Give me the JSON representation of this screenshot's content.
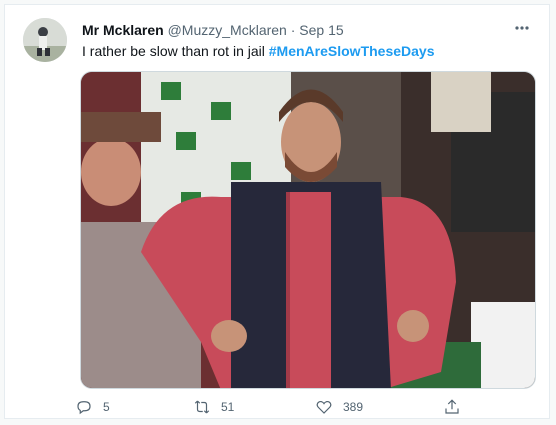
{
  "tweet": {
    "author": {
      "display_name": "Mr Mcklaren",
      "handle": "@Muzzy_Mcklaren",
      "separator": "·",
      "date": "Sep 15"
    },
    "text": "I rather be slow than rot in jail",
    "hashtag": "#MenAreSlowTheseDays",
    "media_alt": "Man in checked shirt and navy vest standing with hands on hips in a stadium crowd",
    "actions": {
      "reply_count": "5",
      "retweet_count": "51",
      "like_count": "389"
    }
  },
  "icons": {
    "more": "more-horizontal-icon",
    "reply": "reply-icon",
    "retweet": "retweet-icon",
    "like": "heart-icon",
    "share": "share-icon"
  },
  "colors": {
    "hashtag": "#1d9bf0",
    "secondary_text": "#536471",
    "primary_text": "#0f1419"
  }
}
